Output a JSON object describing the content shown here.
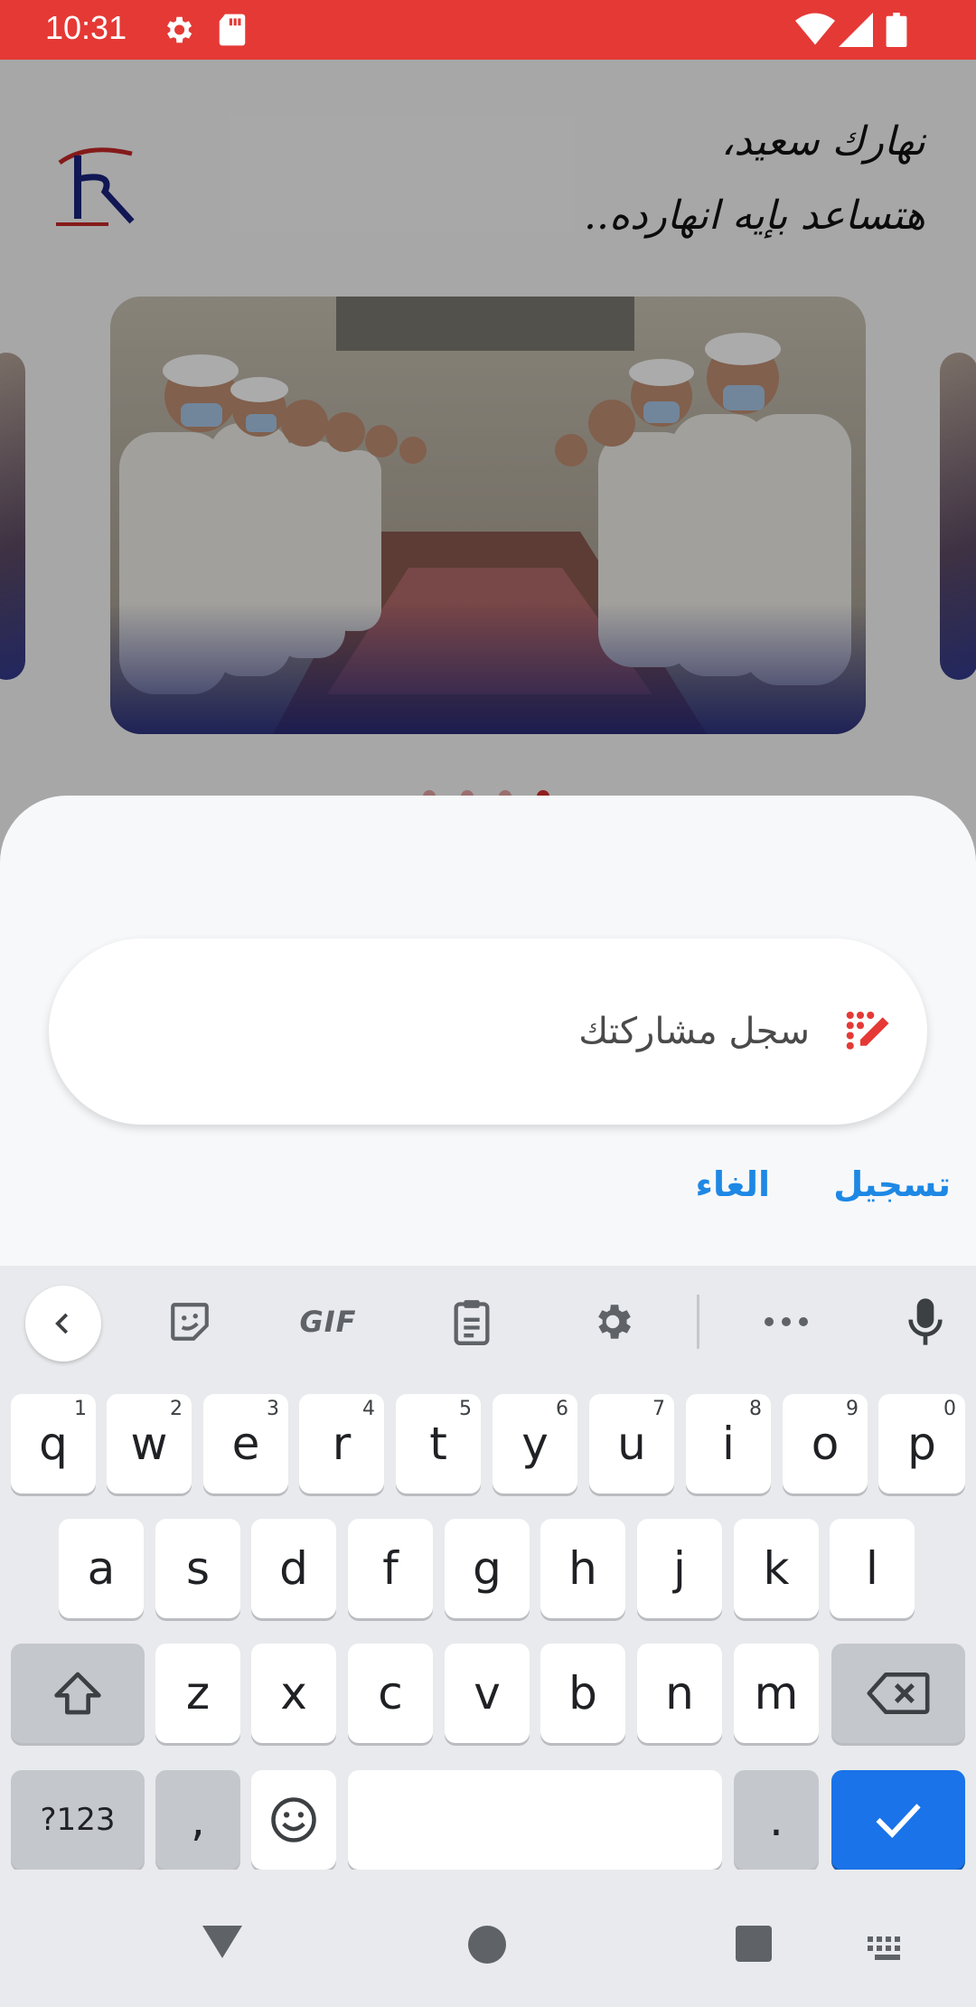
{
  "status_bar": {
    "time": "10:31",
    "icons": [
      "settings-icon",
      "sd-card-icon",
      "wifi-icon",
      "signal-icon",
      "battery-icon"
    ],
    "color": "#e53935"
  },
  "app": {
    "greeting_line1": "نهارك سعيد،",
    "greeting_line2": "هتساعد بإيه انهارده..",
    "logo_letters": "TK",
    "carousel": {
      "page_count": 4,
      "active_index": 3
    }
  },
  "dialog": {
    "input": {
      "value": "",
      "placeholder": "سجل مشاركتك",
      "icon": "edit-icon"
    },
    "register_label": "تسجيل",
    "cancel_label": "الغاء",
    "accent": "#1e88e5"
  },
  "keyboard": {
    "toolbar": {
      "gif_label": "GIF",
      "icons": [
        "chevron-left-icon",
        "sticker-icon",
        "gif-icon",
        "clipboard-icon",
        "gear-icon",
        "more-icon",
        "mic-icon"
      ]
    },
    "row1": [
      {
        "k": "q",
        "h": "1"
      },
      {
        "k": "w",
        "h": "2"
      },
      {
        "k": "e",
        "h": "3"
      },
      {
        "k": "r",
        "h": "4"
      },
      {
        "k": "t",
        "h": "5"
      },
      {
        "k": "y",
        "h": "6"
      },
      {
        "k": "u",
        "h": "7"
      },
      {
        "k": "i",
        "h": "8"
      },
      {
        "k": "o",
        "h": "9"
      },
      {
        "k": "p",
        "h": "0"
      }
    ],
    "row2": [
      "a",
      "s",
      "d",
      "f",
      "g",
      "h",
      "j",
      "k",
      "l"
    ],
    "row3": [
      "z",
      "x",
      "c",
      "v",
      "b",
      "n",
      "m"
    ],
    "symbols_label": "?123",
    "comma_label": ",",
    "period_label": ".",
    "enter_color": "#1a73e8"
  },
  "nav_bar": {
    "icons": [
      "back-icon",
      "home-icon",
      "recents-icon",
      "keyboard-switch-icon"
    ]
  }
}
